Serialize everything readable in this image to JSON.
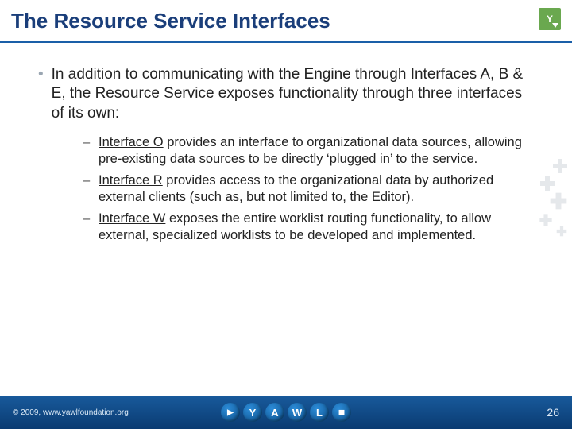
{
  "title": "The Resource Service Interfaces",
  "corner_logo_text": "Y",
  "intro": "In addition to communicating with the Engine through Interfaces A, B & E, the Resource Service exposes functionality through three interfaces of its own:",
  "items": [
    {
      "name": "Interface O",
      "rest": " provides an interface to organizational data sources, allowing pre-existing data sources to be directly ‘plugged in’ to the service."
    },
    {
      "name": "Interface R",
      "rest": " provides access to the organizational data by authorized external clients (such as, but not limited to, the Editor)."
    },
    {
      "name": "Interface W",
      "rest": " exposes the entire worklist routing functionality, to allow external, specialized worklists to be developed and implemented."
    }
  ],
  "footer": {
    "copyright": "© 2009, www.yawlfoundation.org",
    "page": "26"
  },
  "logo_letters": [
    "Y",
    "A",
    "W",
    "L"
  ]
}
